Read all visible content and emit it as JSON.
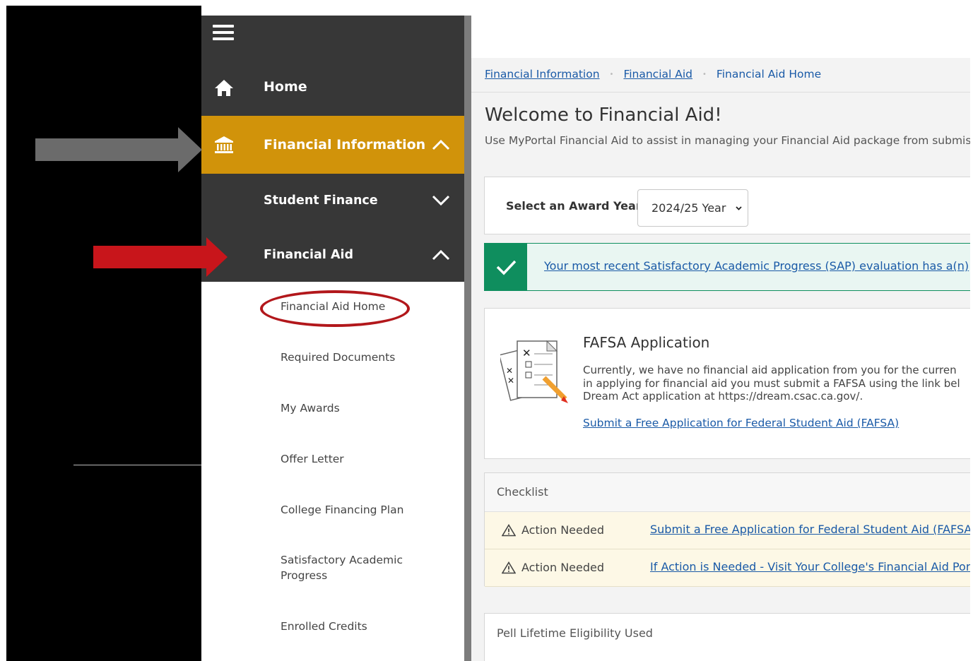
{
  "sidebar": {
    "nav": {
      "home": "Home",
      "financial_information": "Financial Information",
      "student_finance": "Student Finance",
      "financial_aid": "Financial Aid"
    },
    "items": [
      {
        "label": "Financial Aid Home"
      },
      {
        "label": "Required Documents"
      },
      {
        "label": "My Awards"
      },
      {
        "label": "Offer Letter"
      },
      {
        "label": "College Financing Plan"
      },
      {
        "label": "Satisfactory Academic"
      },
      {
        "label": "Progress"
      },
      {
        "label": "Enrolled Credits"
      }
    ],
    "accent_color": "#d1930a",
    "dark_color": "#373737"
  },
  "breadcrumb": {
    "items": [
      "Financial Information",
      "Financial Aid",
      "Financial Aid Home"
    ],
    "sep": "•"
  },
  "page": {
    "title": "Welcome to Financial Aid!",
    "intro": "Use MyPortal Financial Aid to assist in managing your Financial Aid package from submis"
  },
  "award_year": {
    "label": "Select an Award Year:",
    "selected": "2024/25 Year"
  },
  "sap_banner": {
    "text": "Your most recent Satisfactory Academic Progress (SAP) evaluation has a(n)",
    "color": "#0f8e5e"
  },
  "fafsa": {
    "title": "FAFSA Application",
    "body_line1": "Currently, we have no financial aid application from you for the curren",
    "body_line2": "in applying for financial aid you must submit a FAFSA using the link bel",
    "body_line3": "Dream Act application at https://dream.csac.ca.gov/.",
    "link": "Submit a Free Application for Federal Student Aid (FAFSA)"
  },
  "checklist": {
    "title": "Checklist",
    "rows": [
      {
        "status": "Action Needed",
        "link": "Submit a Free Application for Federal Student Aid (FAFSA)"
      },
      {
        "status": "Action Needed",
        "link": "If Action is Needed - Visit Your College's Financial Aid Porta"
      }
    ]
  },
  "pell": {
    "title": "Pell Lifetime Eligibility Used"
  },
  "annotations": {
    "gray_arrow_color": "#6b6b6b",
    "red_arrow_color": "#c8151b"
  }
}
